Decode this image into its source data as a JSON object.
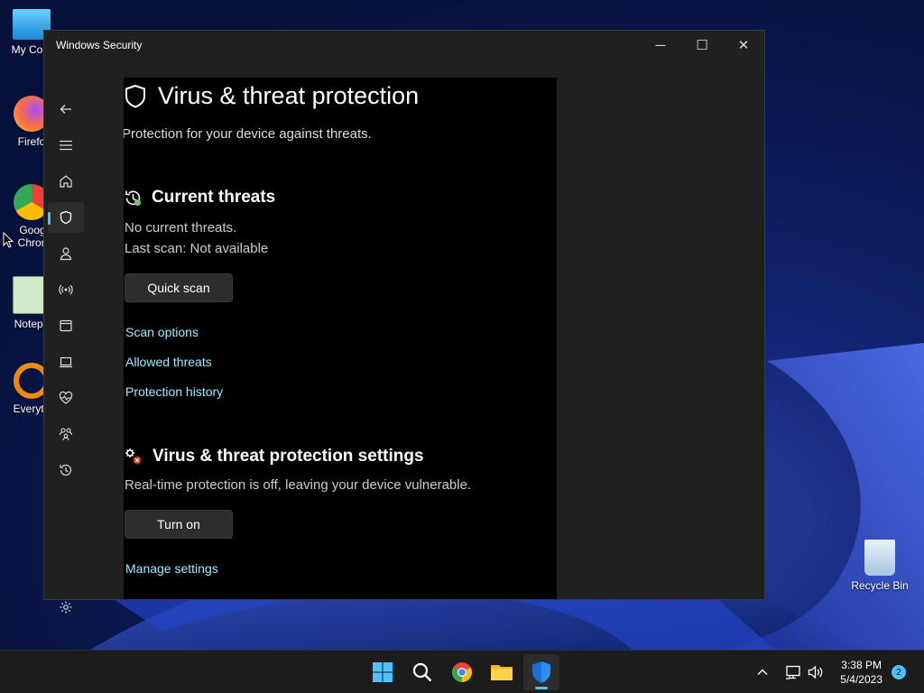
{
  "desktop": {
    "icons": [
      {
        "label": "My Com",
        "name": "my-computer"
      },
      {
        "label": "Firefo",
        "name": "firefox"
      },
      {
        "label": "Goog Chron",
        "name": "google-chrome"
      },
      {
        "label": "Notepa",
        "name": "notepad"
      },
      {
        "label": "Everyth",
        "name": "everything"
      }
    ],
    "recycle_bin": "Recycle Bin"
  },
  "window": {
    "title": "Windows Security",
    "controls": {
      "minimize": "─",
      "maximize": "☐",
      "close": "✕"
    }
  },
  "nav": {
    "items": [
      "back-icon",
      "menu-icon",
      "home-icon",
      "shield-icon",
      "person-icon",
      "wifi-icon",
      "app-browser-icon",
      "laptop-icon",
      "heart-pulse-icon",
      "family-icon",
      "history-icon",
      "settings-icon"
    ],
    "active": "shield-icon"
  },
  "page": {
    "title": "Virus & threat protection",
    "subtitle": "Protection for your device against threats.",
    "current_threats": {
      "heading": "Current threats",
      "status": "No current threats.",
      "last_scan": "Last scan: Not available",
      "quick_scan": "Quick scan",
      "links": [
        "Scan options",
        "Allowed threats",
        "Protection history"
      ]
    },
    "settings": {
      "heading": "Virus & threat protection settings",
      "warning": "Real-time protection is off, leaving your device vulnerable.",
      "turn_on": "Turn on",
      "manage": "Manage settings"
    }
  },
  "taskbar": {
    "apps": [
      "start-icon",
      "search-icon",
      "chrome-icon",
      "file-explorer-icon",
      "windows-security-icon"
    ],
    "clock": {
      "time": "3:38 PM",
      "date": "5/4/2023"
    },
    "notifications": "2"
  },
  "colors": {
    "accent": "#4cc2ff",
    "link": "#99ebff",
    "window_bg": "#202020",
    "content_bg": "#000000"
  }
}
